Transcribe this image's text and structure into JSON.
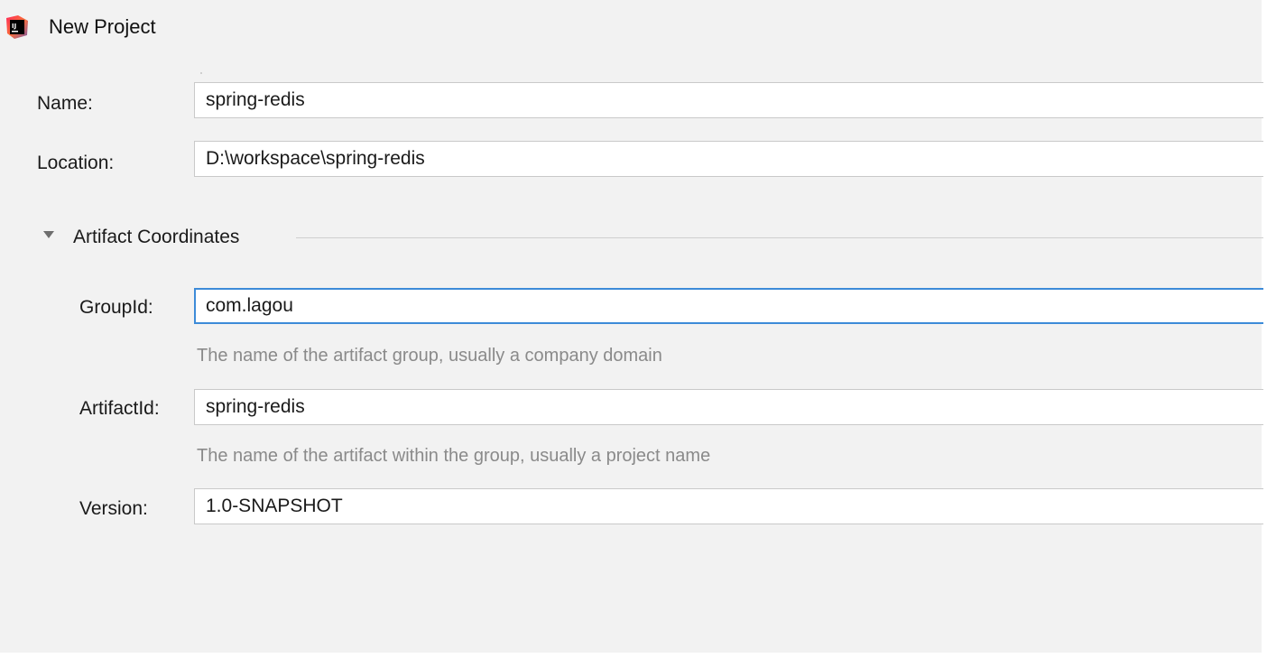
{
  "window": {
    "title": "New Project",
    "app_icon": "intellij-idea-icon"
  },
  "form": {
    "name": {
      "label": "Name:",
      "value": "spring-redis"
    },
    "location": {
      "label": "Location:",
      "value": "D:\\workspace\\spring-redis"
    },
    "artifact_section": {
      "title": "Artifact Coordinates",
      "expanded": true,
      "caret_icon": "triangle-down-icon"
    },
    "group_id": {
      "label": "GroupId:",
      "value": "com.lagou",
      "hint": "The name of the artifact group, usually a company domain",
      "focused": true
    },
    "artifact_id": {
      "label": "ArtifactId:",
      "value": "spring-redis",
      "hint": "The name of the artifact within the group, usually a project name"
    },
    "version": {
      "label": "Version:",
      "value": "1.0-SNAPSHOT"
    }
  },
  "colors": {
    "background": "#f2f2f2",
    "focus_border": "#3d8bd8",
    "hint_text": "#8a8a8a"
  }
}
